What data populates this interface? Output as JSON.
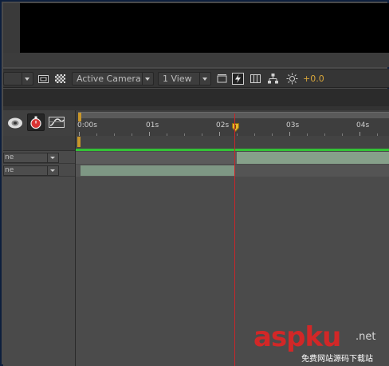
{
  "toolbar": {
    "channel_dropdown_arrow": "chevron-down-icon",
    "camera_dropdown": "Active Camera",
    "view_dropdown": "1 View",
    "exposure_value": "+0.0"
  },
  "timeline": {
    "ruler_labels": [
      "0:00s",
      "01s",
      "02s",
      "03s",
      "04s"
    ],
    "playhead_time_seconds": 2.2,
    "layers": [
      {
        "mode": "ne"
      },
      {
        "mode": "ne"
      }
    ]
  },
  "colors": {
    "playhead": "#c8262a",
    "work_area_handle": "#c8962a",
    "layer_bar": "#86a08a",
    "green_line": "#33c236",
    "exposure": "#d8a63a"
  },
  "watermark": {
    "brand": "aspku",
    "suffix": ".net",
    "tagline": "免费网站源码下载站"
  }
}
